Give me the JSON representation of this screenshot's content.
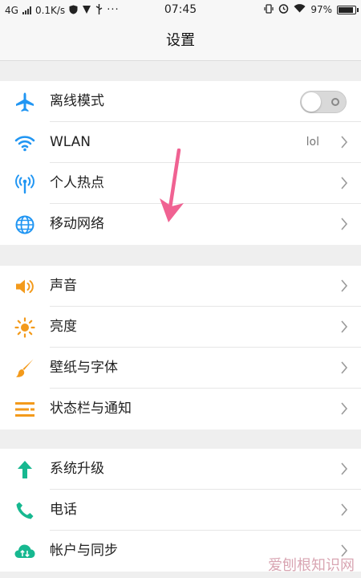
{
  "status_bar": {
    "network": "4G",
    "speed": "0.1K/s",
    "time": "07:45",
    "battery": "97%",
    "battery_level": 0.97
  },
  "header": {
    "title": "设置"
  },
  "groups": [
    {
      "items": [
        {
          "label": "离线模式",
          "icon": "airplane-icon",
          "toggle": false
        },
        {
          "label": "WLAN",
          "icon": "wifi-icon",
          "value": "lol"
        },
        {
          "label": "个人热点",
          "icon": "hotspot-icon"
        },
        {
          "label": "移动网络",
          "icon": "globe-icon"
        }
      ]
    },
    {
      "items": [
        {
          "label": "声音",
          "icon": "speaker-icon"
        },
        {
          "label": "亮度",
          "icon": "sun-icon"
        },
        {
          "label": "壁纸与字体",
          "icon": "brush-icon"
        },
        {
          "label": "状态栏与通知",
          "icon": "list-icon"
        }
      ]
    },
    {
      "items": [
        {
          "label": "系统升级",
          "icon": "arrow-up-icon"
        },
        {
          "label": "电话",
          "icon": "phone-icon"
        },
        {
          "label": "帐户与同步",
          "icon": "cloud-sync-icon"
        }
      ]
    }
  ],
  "watermark": "爱刨根知识网",
  "colors": {
    "blue": "#2196f3",
    "orange": "#f39a1b",
    "green": "#17b890",
    "annotation": "#f06292"
  }
}
